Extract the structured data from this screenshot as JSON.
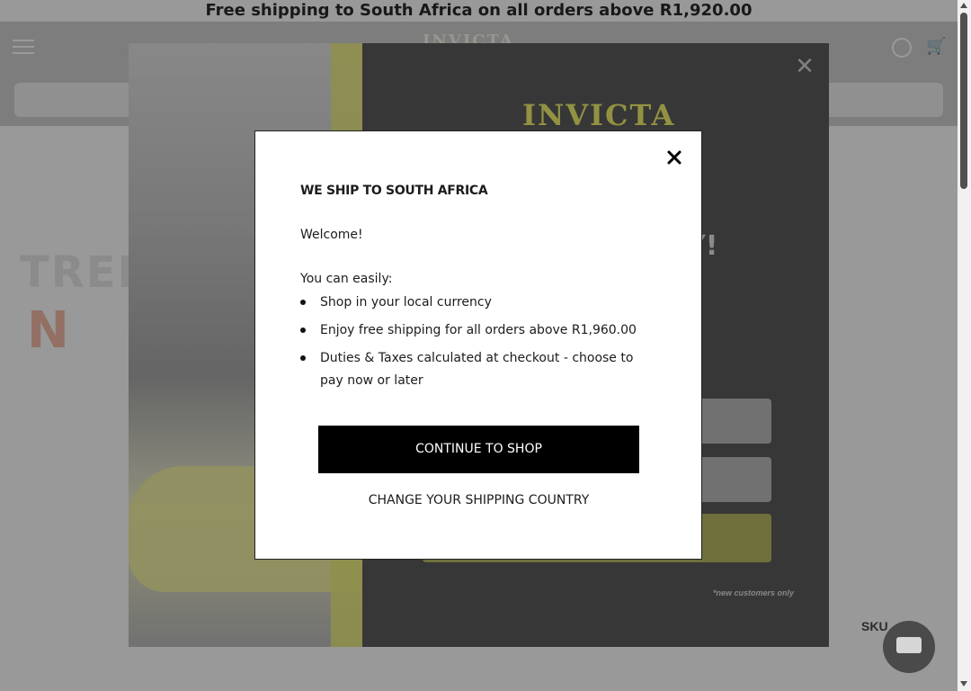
{
  "announcement": "Free shipping to South Africa on all orders above R1,920.00",
  "header": {
    "logo": "INVICTA",
    "search_placeholder": "",
    "breadcrumb": ""
  },
  "background": {
    "hero_line1": "TREN",
    "hero_line2": "N",
    "sku": "SKU",
    "chat": ""
  },
  "promo": {
    "logo": "INVICTA",
    "headline_tail": "Y!",
    "note": "*new customers only"
  },
  "modal": {
    "title": "WE SHIP TO SOUTH AFRICA",
    "welcome": "Welcome!",
    "easily": "You can easily:",
    "bullets": [
      "Shop in your local currency",
      "Enjoy free shipping for all orders above R1,960.00",
      "Duties & Taxes calculated at checkout - choose to pay now or later"
    ],
    "continue_label": "CONTINUE TO SHOP",
    "change_label": "CHANGE YOUR SHIPPING COUNTRY"
  },
  "colors": {
    "overlay": "#000000",
    "promo_accent": "#f3f36e",
    "primary_button": "#000000",
    "primary_button_text": "#ffffff"
  },
  "icons": [
    "hamburger-menu-icon",
    "account-icon",
    "cart-icon",
    "close-icon",
    "chat-icon"
  ]
}
